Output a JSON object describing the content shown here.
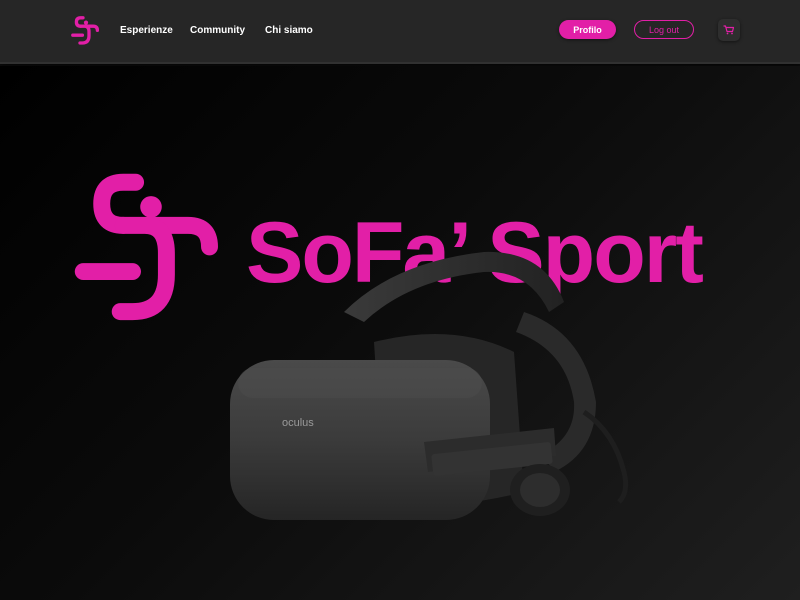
{
  "nav": {
    "links": [
      "Esperienze",
      "Community",
      "Chi siamo"
    ],
    "profile_label": "Profilo",
    "logout_label": "Log out",
    "cart_icon": "cart-icon"
  },
  "hero": {
    "title": "SoFa’ Sport",
    "headset_brand": "oculus"
  },
  "colors": {
    "accent": "#e21fa7",
    "navbar": "#262626",
    "background": "#0c0c0c",
    "headset": "#3a3a3a"
  }
}
